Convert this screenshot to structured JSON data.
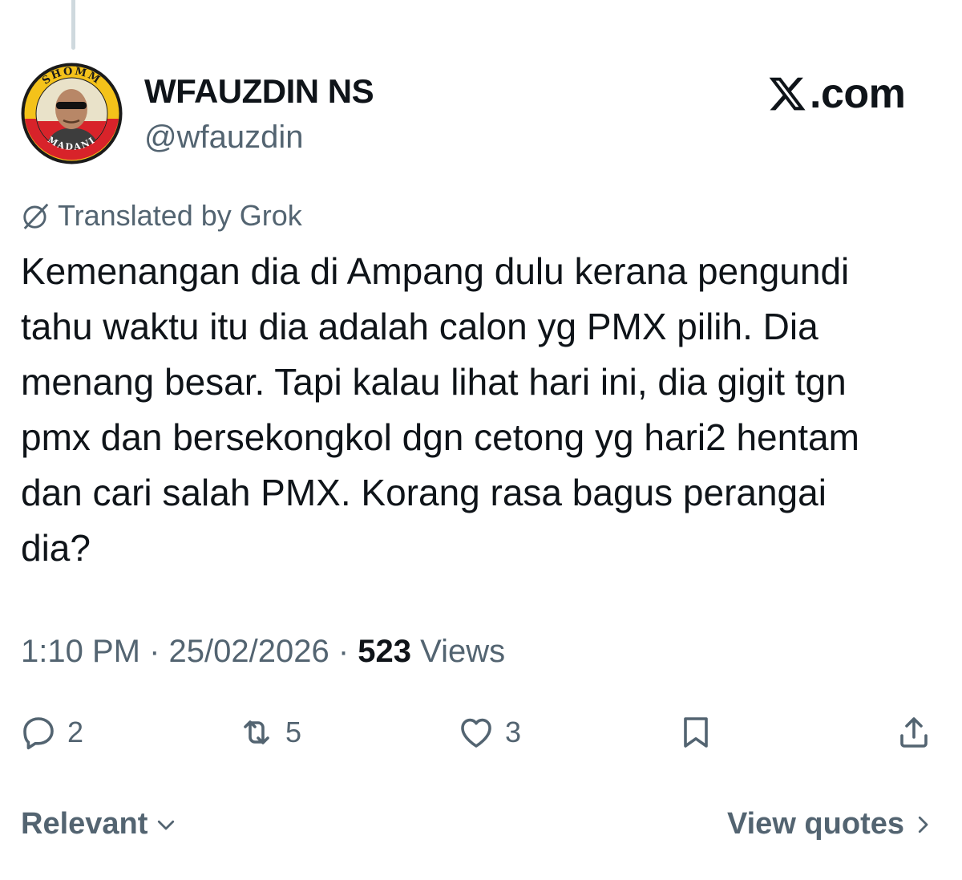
{
  "author": {
    "display_name": "WFAUZDIN NS",
    "handle": "@wfauzdin",
    "avatar_ring_top": "SHOMM",
    "avatar_ring_bottom": "MADANI"
  },
  "brand": {
    "text": ".com",
    "icon": "x-logo-icon"
  },
  "translation": {
    "label": "Translated by Grok",
    "icon": "grok-icon"
  },
  "tweet": {
    "lines": [
      "Kemenangan dia di Ampang dulu kerana pengundi",
      "tahu waktu itu dia adalah calon yg PMX pilih.  Dia",
      "menang besar.  Tapi kalau lihat hari ini, dia gigit tgn",
      "pmx dan bersekongkol dgn cetong yg hari2 hentam",
      "dan cari salah PMX.  Korang rasa bagus perangai",
      "dia?"
    ]
  },
  "meta": {
    "time": "1:10 PM",
    "separator": " · ",
    "date": "25/02/2026",
    "views_count": "523",
    "views_label": " Views"
  },
  "actions": {
    "reply": {
      "icon": "reply-icon",
      "count": "2"
    },
    "repost": {
      "icon": "repost-icon",
      "count": "5"
    },
    "like": {
      "icon": "heart-icon",
      "count": "3"
    },
    "bookmark": {
      "icon": "bookmark-icon"
    },
    "share": {
      "icon": "share-icon"
    }
  },
  "footer": {
    "sort_label": "Relevant",
    "quotes_label": "View quotes"
  },
  "colors": {
    "text": "#0f1419",
    "secondary": "#536471",
    "thread_line": "#cfd9de",
    "avatar_yellow": "#f4c21a",
    "avatar_red": "#d8232a"
  }
}
